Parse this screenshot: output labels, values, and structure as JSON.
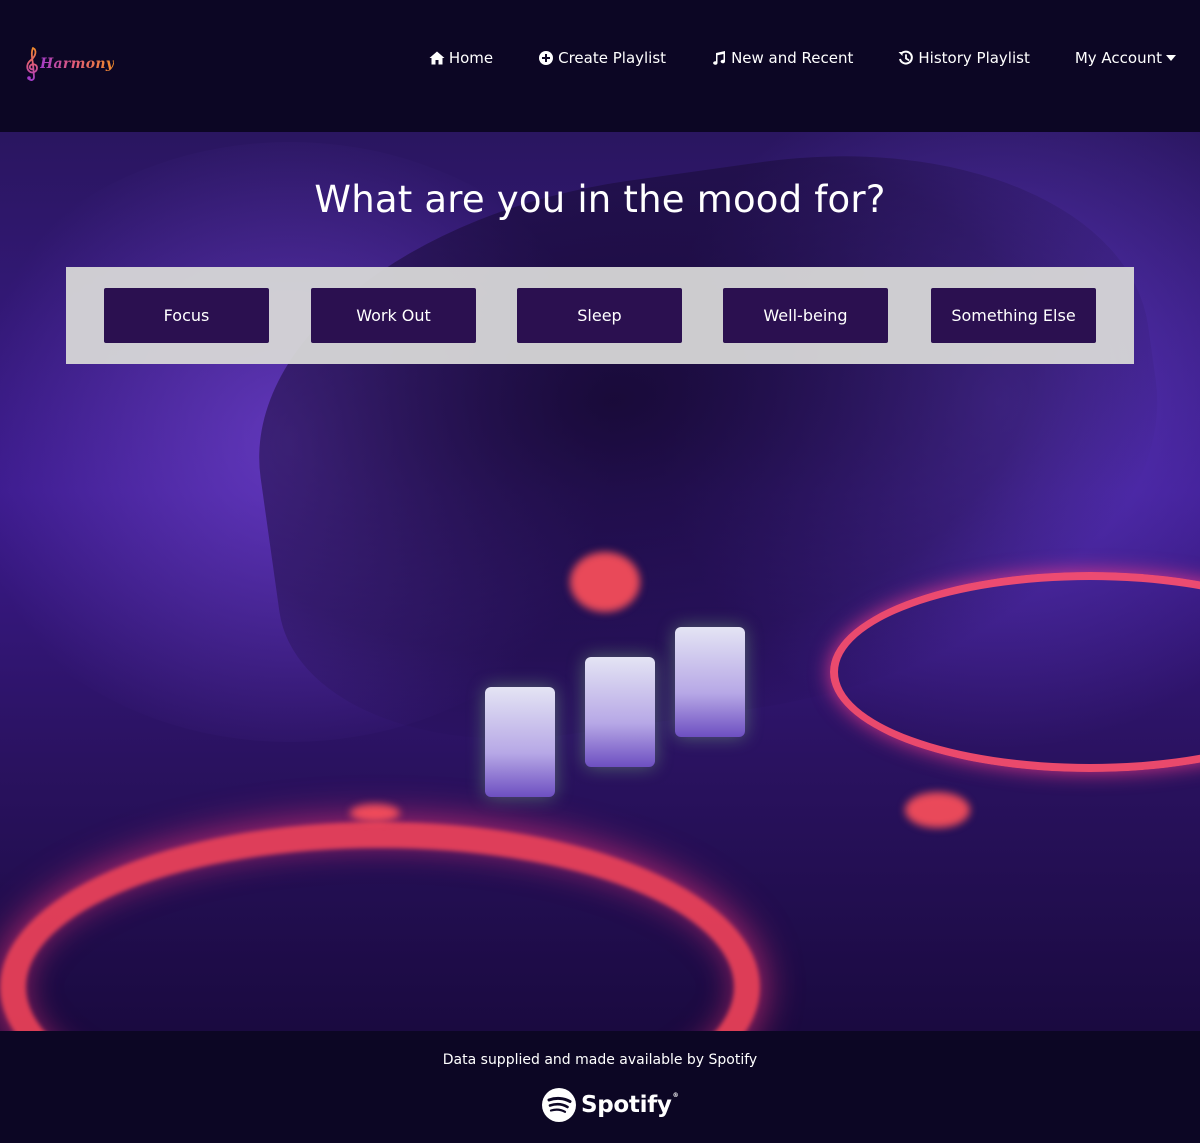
{
  "brand": {
    "name": "Harmony",
    "colors": {
      "start": "#a33cc8",
      "mid": "#e05a7a",
      "end": "#f08a2a"
    }
  },
  "nav": {
    "items": [
      {
        "label": "Home",
        "icon": "home-icon"
      },
      {
        "label": "Create Playlist",
        "icon": "plus-circle-icon"
      },
      {
        "label": "New and Recent",
        "icon": "music-note-icon"
      },
      {
        "label": "History Playlist",
        "icon": "history-icon"
      },
      {
        "label": "My Account",
        "icon": "caret-down-icon"
      }
    ]
  },
  "hero": {
    "headline": "What are you in the mood for?",
    "background_image": "dj-mixer-hand-neon-purple"
  },
  "moods": [
    {
      "label": "Focus"
    },
    {
      "label": "Work Out"
    },
    {
      "label": "Sleep"
    },
    {
      "label": "Well-being"
    },
    {
      "label": "Something Else"
    }
  ],
  "footer": {
    "attribution": "Data supplied and made available by Spotify",
    "logo_text": "Spotify",
    "logo_icon": "spotify-icon"
  },
  "colors": {
    "navbar_bg": "#0c0624",
    "button_bg": "#2b1050",
    "panel_bg": "#d7d7d7",
    "text": "#ffffff"
  }
}
